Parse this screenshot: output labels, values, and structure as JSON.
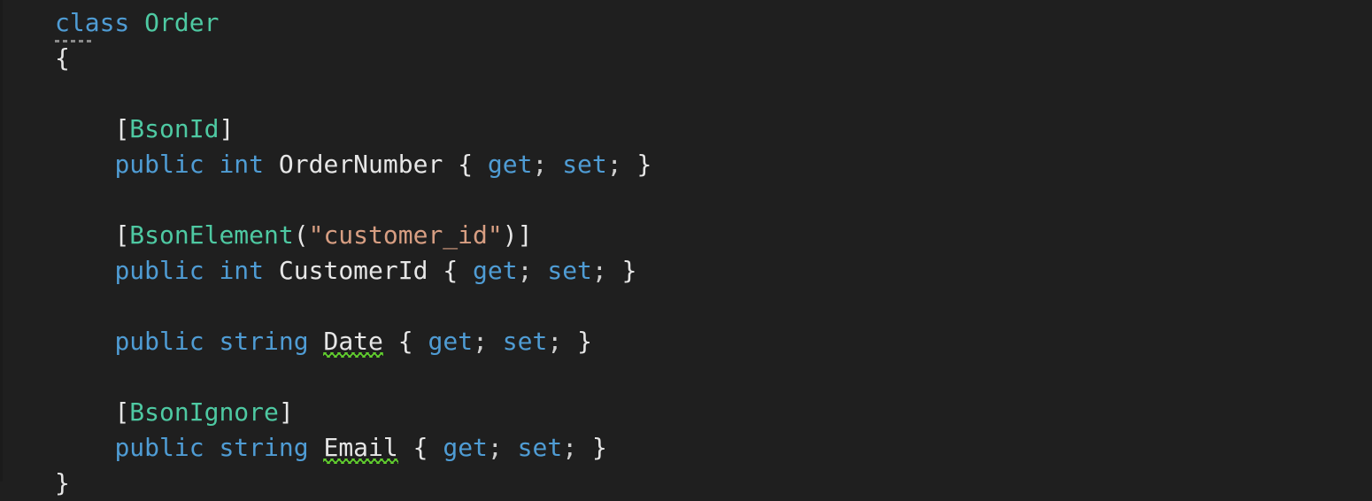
{
  "editor": {
    "background_color": "#1f1f1f",
    "language": "csharp",
    "theme": "dark",
    "colors": {
      "keyword": "#4f9cd4",
      "type": "#4ec9a2",
      "identifier": "#e6e6e6",
      "punctuation": "#e6e6e6",
      "string": "#d79e82",
      "squiggle_suggestion": "#62d12e",
      "fold_marker": "#8a8a8a"
    },
    "fold_marker": {
      "name": "collapsed-region-marker",
      "dash_count": 5
    },
    "lines": [
      {
        "index": 1,
        "indent": 0,
        "tokens": [
          {
            "text": "class",
            "kind": "kw"
          },
          {
            "text": " ",
            "kind": "punct"
          },
          {
            "text": "Order",
            "kind": "type"
          }
        ]
      },
      {
        "index": 2,
        "indent": 0,
        "tokens": [
          {
            "text": "{",
            "kind": "punct"
          }
        ]
      },
      {
        "index": 3,
        "indent": 0,
        "tokens": []
      },
      {
        "index": 4,
        "indent": 1,
        "tokens": [
          {
            "text": "[",
            "kind": "punct"
          },
          {
            "text": "BsonId",
            "kind": "type"
          },
          {
            "text": "]",
            "kind": "punct"
          }
        ]
      },
      {
        "index": 5,
        "indent": 1,
        "tokens": [
          {
            "text": "public",
            "kind": "kw"
          },
          {
            "text": " ",
            "kind": "punct"
          },
          {
            "text": "int",
            "kind": "kw"
          },
          {
            "text": " ",
            "kind": "punct"
          },
          {
            "text": "OrderNumber",
            "kind": "ident"
          },
          {
            "text": " ",
            "kind": "punct"
          },
          {
            "text": "{",
            "kind": "punct"
          },
          {
            "text": " ",
            "kind": "punct"
          },
          {
            "text": "get",
            "kind": "kw"
          },
          {
            "text": ";",
            "kind": "semi"
          },
          {
            "text": " ",
            "kind": "punct"
          },
          {
            "text": "set",
            "kind": "kw"
          },
          {
            "text": ";",
            "kind": "semi"
          },
          {
            "text": " ",
            "kind": "punct"
          },
          {
            "text": "}",
            "kind": "punct"
          }
        ]
      },
      {
        "index": 6,
        "indent": 0,
        "tokens": []
      },
      {
        "index": 7,
        "indent": 1,
        "tokens": [
          {
            "text": "[",
            "kind": "punct"
          },
          {
            "text": "BsonElement",
            "kind": "type"
          },
          {
            "text": "(",
            "kind": "punct"
          },
          {
            "text": "\"customer_id\"",
            "kind": "str"
          },
          {
            "text": ")",
            "kind": "punct"
          },
          {
            "text": "]",
            "kind": "punct"
          }
        ]
      },
      {
        "index": 8,
        "indent": 1,
        "tokens": [
          {
            "text": "public",
            "kind": "kw"
          },
          {
            "text": " ",
            "kind": "punct"
          },
          {
            "text": "int",
            "kind": "kw"
          },
          {
            "text": " ",
            "kind": "punct"
          },
          {
            "text": "CustomerId",
            "kind": "ident"
          },
          {
            "text": " ",
            "kind": "punct"
          },
          {
            "text": "{",
            "kind": "punct"
          },
          {
            "text": " ",
            "kind": "punct"
          },
          {
            "text": "get",
            "kind": "kw"
          },
          {
            "text": ";",
            "kind": "semi"
          },
          {
            "text": " ",
            "kind": "punct"
          },
          {
            "text": "set",
            "kind": "kw"
          },
          {
            "text": ";",
            "kind": "semi"
          },
          {
            "text": " ",
            "kind": "punct"
          },
          {
            "text": "}",
            "kind": "punct"
          }
        ]
      },
      {
        "index": 9,
        "indent": 0,
        "tokens": []
      },
      {
        "index": 10,
        "indent": 1,
        "tokens": [
          {
            "text": "public",
            "kind": "kw"
          },
          {
            "text": " ",
            "kind": "punct"
          },
          {
            "text": "string",
            "kind": "kw"
          },
          {
            "text": " ",
            "kind": "punct"
          },
          {
            "text": "Date",
            "kind": "ident",
            "squiggle": true
          },
          {
            "text": " ",
            "kind": "punct"
          },
          {
            "text": "{",
            "kind": "punct"
          },
          {
            "text": " ",
            "kind": "punct"
          },
          {
            "text": "get",
            "kind": "kw"
          },
          {
            "text": ";",
            "kind": "semi"
          },
          {
            "text": " ",
            "kind": "punct"
          },
          {
            "text": "set",
            "kind": "kw"
          },
          {
            "text": ";",
            "kind": "semi"
          },
          {
            "text": " ",
            "kind": "punct"
          },
          {
            "text": "}",
            "kind": "punct"
          }
        ]
      },
      {
        "index": 11,
        "indent": 0,
        "tokens": []
      },
      {
        "index": 12,
        "indent": 1,
        "tokens": [
          {
            "text": "[",
            "kind": "punct"
          },
          {
            "text": "BsonIgnore",
            "kind": "type"
          },
          {
            "text": "]",
            "kind": "punct"
          }
        ]
      },
      {
        "index": 13,
        "indent": 1,
        "tokens": [
          {
            "text": "public",
            "kind": "kw"
          },
          {
            "text": " ",
            "kind": "punct"
          },
          {
            "text": "string",
            "kind": "kw"
          },
          {
            "text": " ",
            "kind": "punct"
          },
          {
            "text": "Email",
            "kind": "ident",
            "squiggle": true
          },
          {
            "text": " ",
            "kind": "punct"
          },
          {
            "text": "{",
            "kind": "punct"
          },
          {
            "text": " ",
            "kind": "punct"
          },
          {
            "text": "get",
            "kind": "kw"
          },
          {
            "text": ";",
            "kind": "semi"
          },
          {
            "text": " ",
            "kind": "punct"
          },
          {
            "text": "set",
            "kind": "kw"
          },
          {
            "text": ";",
            "kind": "semi"
          },
          {
            "text": " ",
            "kind": "punct"
          },
          {
            "text": "}",
            "kind": "punct"
          }
        ]
      },
      {
        "index": 14,
        "indent": 0,
        "tokens": [
          {
            "text": "}",
            "kind": "punct"
          }
        ]
      }
    ]
  }
}
